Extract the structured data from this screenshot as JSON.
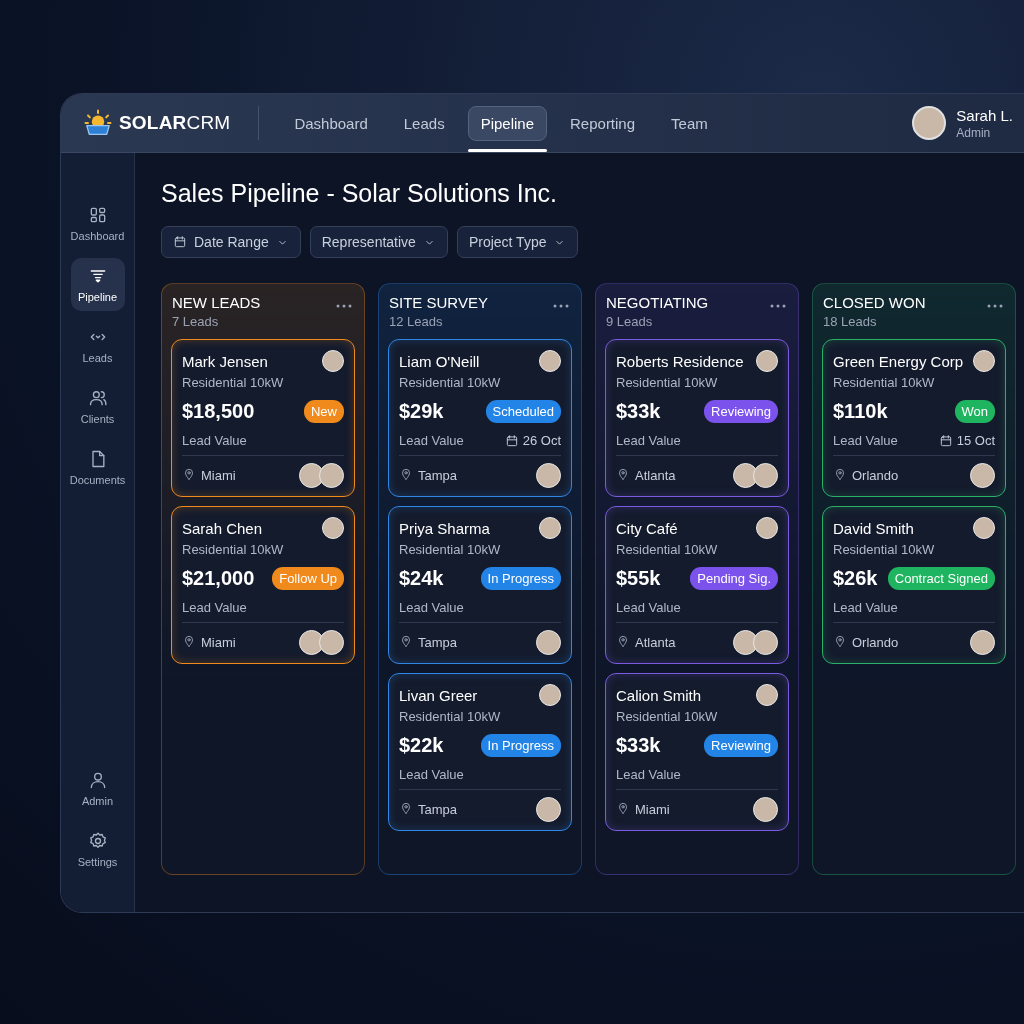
{
  "brand": {
    "bold": "SOLAR",
    "light": "CRM"
  },
  "nav_tabs": [
    {
      "label": "Dashboard",
      "selected": false
    },
    {
      "label": "Leads",
      "selected": false
    },
    {
      "label": "Pipeline",
      "selected": true
    },
    {
      "label": "Reporting",
      "selected": false
    },
    {
      "label": "Team",
      "selected": false
    }
  ],
  "user": {
    "name": "Sarah L.",
    "role": "Admin"
  },
  "sidebar": {
    "items": [
      {
        "label": "Dashboard",
        "kind": "grid",
        "selected": false
      },
      {
        "label": "Pipeline",
        "kind": "funnel",
        "selected": true
      },
      {
        "label": "Leads",
        "kind": "code",
        "selected": false
      },
      {
        "label": "Clients",
        "kind": "people",
        "selected": false
      },
      {
        "label": "Documents",
        "kind": "document",
        "selected": false
      }
    ],
    "bottom_items": [
      {
        "label": "Admin",
        "kind": "person",
        "selected": false
      },
      {
        "label": "Settings",
        "kind": "gear",
        "selected": false
      }
    ]
  },
  "page_title": "Sales Pipeline - Solar Solutions Inc.",
  "filters": [
    {
      "label": "Date Range",
      "kind": "date"
    },
    {
      "label": "Representative",
      "kind": "plain"
    },
    {
      "label": "Project Type",
      "kind": "plain"
    }
  ],
  "columns": [
    {
      "title": "NEW LEADS",
      "count": "7 Leads",
      "color": "#f08a1c",
      "cards": [
        {
          "name": "Mark Jensen",
          "subtitle": "Residential 10kW",
          "value": "$18,500",
          "value_label": "Lead Value",
          "badge": {
            "label": "New",
            "color": "#f08a1c"
          },
          "location": "Miami",
          "assignees": [
            {
              "kind": "person"
            },
            {
              "kind": "person"
            }
          ]
        },
        {
          "name": "Sarah Chen",
          "subtitle": "Residential 10kW",
          "value": "$21,000",
          "value_label": "Lead Value",
          "badge": {
            "label": "Follow Up",
            "color": "#f08a1c"
          },
          "location": "Miami",
          "assignees": [
            {
              "kind": "person"
            },
            {
              "kind": "person"
            }
          ]
        }
      ]
    },
    {
      "title": "SITE SURVEY",
      "count": "12 Leads",
      "color": "#2f86e6",
      "cards": [
        {
          "name": "Liam O'Neill",
          "subtitle": "Residential 10kW",
          "value": "$29k",
          "value_label": "Lead Value",
          "date": "26 Oct",
          "badge": {
            "label": "Scheduled",
            "color": "#2384e8"
          },
          "location": "Tampa",
          "assignees": [
            {
              "kind": "person"
            }
          ]
        },
        {
          "name": "Priya Sharma",
          "subtitle": "Residential 10kW",
          "value": "$24k",
          "value_label": "Lead Value",
          "badge": {
            "label": "In Progress",
            "color": "#2384e8"
          },
          "location": "Tampa",
          "assignees": [
            {
              "kind": "person"
            }
          ]
        },
        {
          "name": "Livan Greer",
          "subtitle": "Residential 10kW",
          "value": "$22k",
          "value_label": "Lead Value",
          "badge": {
            "label": "In Progress",
            "color": "#2384e8"
          },
          "location": "Tampa",
          "assignees": [
            {
              "kind": "person"
            }
          ]
        }
      ]
    },
    {
      "title": "NEGOTIATING",
      "count": "9 Leads",
      "color": "#7a5ae0",
      "cards": [
        {
          "name": "Roberts Residence",
          "subtitle": "Residential 10kW",
          "value": "$33k",
          "value_label": "Lead Value",
          "badge": {
            "label": "Reviewing",
            "color": "#7b52ec"
          },
          "location": "Atlanta",
          "assignees": [
            {
              "kind": "person"
            },
            {
              "kind": "person"
            }
          ]
        },
        {
          "name": "City Café",
          "subtitle": "Residential 10kW",
          "value": "$55k",
          "value_label": "Lead Value",
          "badge": {
            "label": "Pending Sig.",
            "color": "#7b52ec"
          },
          "location": "Atlanta",
          "assignees": [
            {
              "kind": "person"
            },
            {
              "kind": "person"
            }
          ]
        },
        {
          "name": "Calion Smith",
          "subtitle": "Residential 10kW",
          "value": "$33k",
          "value_label": "Lead Value",
          "badge": {
            "label": "Reviewing",
            "color": "#2384e8"
          },
          "location": "Miami",
          "assignees": [
            {
              "kind": "person"
            }
          ]
        }
      ]
    },
    {
      "title": "CLOSED WON",
      "count": "18 Leads",
      "color": "#2bb06a",
      "cards": [
        {
          "name": "Green Energy Corp",
          "subtitle": "Residential 10kW",
          "value": "$110k",
          "value_label": "Lead Value",
          "date": "15 Oct",
          "badge": {
            "label": "Won",
            "color": "#1fb45f"
          },
          "location": "Orlando",
          "assignees": [
            {
              "kind": "person"
            }
          ]
        },
        {
          "name": "David Smith",
          "subtitle": "Residential 10kW",
          "value": "$26k",
          "value_label": "Lead Value",
          "badge": {
            "label": "Contract Signed",
            "color": "#1fb45f"
          },
          "location": "Orlando",
          "assignees": [
            {
              "kind": "person"
            }
          ]
        }
      ]
    }
  ]
}
